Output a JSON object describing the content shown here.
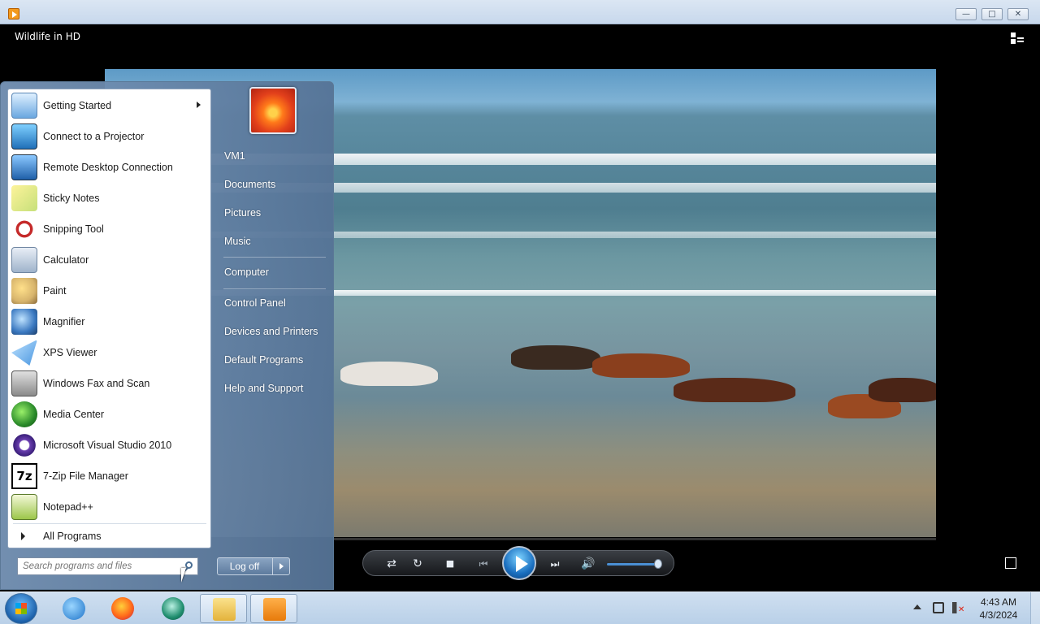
{
  "window": {
    "title": "Wildlife in HD",
    "controls": {
      "minimize": "minimize",
      "maximize": "maximize",
      "close": "close"
    }
  },
  "player": {
    "controls": [
      "shuffle-icon",
      "repeat-icon",
      "stop-icon",
      "previous-icon",
      "play-icon",
      "next-icon",
      "volume-icon"
    ],
    "volume_level": 0.9
  },
  "start_menu": {
    "programs": [
      {
        "label": "Getting Started",
        "icon": "getting-started-icon",
        "has_submenu": true
      },
      {
        "label": "Connect to a Projector",
        "icon": "projector-icon"
      },
      {
        "label": "Remote Desktop Connection",
        "icon": "remote-desktop-icon"
      },
      {
        "label": "Sticky Notes",
        "icon": "sticky-notes-icon"
      },
      {
        "label": "Snipping Tool",
        "icon": "scissors-icon"
      },
      {
        "label": "Calculator",
        "icon": "calculator-icon"
      },
      {
        "label": "Paint",
        "icon": "paint-icon"
      },
      {
        "label": "Magnifier",
        "icon": "magnifier-icon"
      },
      {
        "label": "XPS Viewer",
        "icon": "xps-viewer-icon"
      },
      {
        "label": "Windows Fax and Scan",
        "icon": "fax-icon"
      },
      {
        "label": "Media Center",
        "icon": "media-center-icon"
      },
      {
        "label": "Microsoft Visual Studio 2010",
        "icon": "visual-studio-icon"
      },
      {
        "label": "7-Zip File Manager",
        "icon": "seven-zip-icon"
      },
      {
        "label": "Notepad++",
        "icon": "notepad-plus-icon"
      }
    ],
    "all_programs": "All Programs",
    "search_placeholder": "Search programs and files",
    "right_items": [
      {
        "label": "VM1"
      },
      {
        "label": "Documents"
      },
      {
        "label": "Pictures"
      },
      {
        "label": "Music"
      },
      {
        "label": "Computer"
      },
      {
        "label": "Control Panel"
      },
      {
        "label": "Devices and Printers"
      },
      {
        "label": "Default Programs"
      },
      {
        "label": "Help and Support"
      }
    ],
    "log_off": "Log off"
  },
  "taskbar": {
    "pinned": [
      "internet-explorer-icon",
      "firefox-icon",
      "app-icon",
      "file-explorer-icon",
      "media-player-icon"
    ],
    "clock": {
      "time": "4:43 AM",
      "date": "4/3/2024"
    }
  },
  "colors": {
    "accent": "#1a6fc0",
    "start_menu_right": "#6f8fb3",
    "taskbar": "#c4d8ee"
  }
}
